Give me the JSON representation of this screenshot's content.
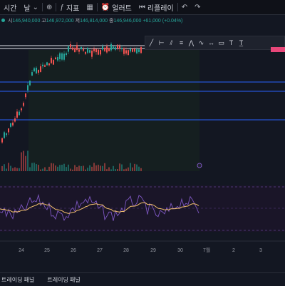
{
  "topbar": {
    "items": [
      {
        "label": "시간",
        "icon": "clock-icon"
      },
      {
        "label": "날",
        "icon": "chevron-down-icon"
      },
      {
        "label": "",
        "icon": "compare-icon"
      },
      {
        "label": "지표",
        "icon": "indicator-icon"
      },
      {
        "label": "",
        "icon": "layout-icon"
      },
      {
        "label": "얼러트",
        "icon": "alert-clock-icon"
      },
      {
        "label": "리플레이",
        "icon": "replay-icon"
      },
      {
        "label": "",
        "icon": "undo-icon"
      },
      {
        "label": "",
        "icon": "redo-icon"
      }
    ]
  },
  "ohlc": {
    "open_label": "시",
    "open": "146,940,000",
    "high_label": "고",
    "high": "146,972,000",
    "low_label": "저",
    "low": "146,814,000",
    "close_label": "종",
    "close": "146,946,000",
    "change": "+61,000 (+0.04%)"
  },
  "drawing_tools": [
    "trend-line-icon",
    "horizontal-ray-icon",
    "parallel-channel-icon",
    "fib-retracement-icon",
    "xabcd-pattern-icon",
    "elliott-wave-icon",
    "date-range-icon",
    "long-position-icon",
    "text-icon",
    "text-note-icon"
  ],
  "colors": {
    "up": "#26a69a",
    "down": "#ef5350",
    "accent": "#e8477a",
    "hline": "#2962ff"
  },
  "x_axis": {
    "labels": [
      "24",
      "25",
      "26",
      "27",
      "28",
      "29",
      "30",
      "7월",
      "2",
      "3"
    ]
  },
  "bottombar": {
    "tabs": [
      "트레이딩 패널",
      "트레이딩 패널"
    ]
  },
  "chart_data": {
    "type": "candlestick",
    "x": [
      "24",
      "25",
      "26",
      "27",
      "28",
      "29",
      "30"
    ],
    "panes": [
      "price",
      "volume",
      "oscillator"
    ]
  }
}
